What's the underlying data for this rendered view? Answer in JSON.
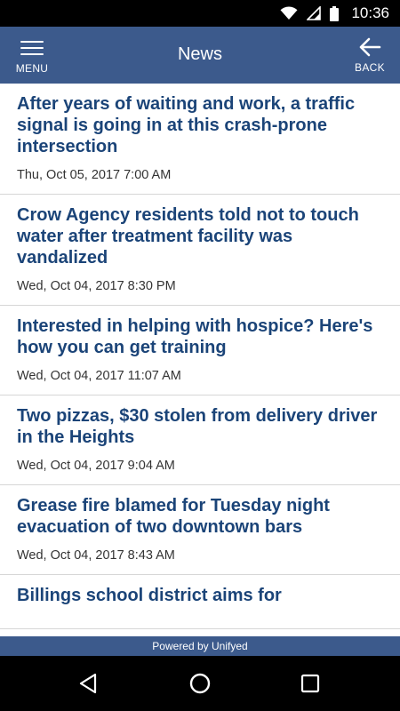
{
  "status_bar": {
    "time": "10:36",
    "icons": [
      "wifi-icon",
      "signal-icon",
      "battery-icon"
    ]
  },
  "app_bar": {
    "title": "News",
    "menu_label": "MENU",
    "back_label": "BACK",
    "background_color": "#3c5a8c"
  },
  "news": {
    "headline_color": "#1b4478",
    "items": [
      {
        "headline": "After years of waiting and work, a traffic signal is going in at this crash-prone intersection",
        "date": "Thu, Oct 05, 2017 7:00 AM"
      },
      {
        "headline": "Crow Agency residents told not to touch water after treatment facility was vandalized",
        "date": "Wed, Oct 04, 2017 8:30 PM"
      },
      {
        "headline": "Interested in helping with hospice? Here's how you can get training",
        "date": "Wed, Oct 04, 2017 11:07 AM"
      },
      {
        "headline": "Two pizzas, $30 stolen from delivery driver in the Heights",
        "date": "Wed, Oct 04, 2017 9:04 AM"
      },
      {
        "headline": "Grease fire blamed for Tuesday night evacuation of two downtown bars",
        "date": "Wed, Oct 04, 2017 8:43 AM"
      },
      {
        "headline": "Billings school district aims for",
        "date": ""
      }
    ]
  },
  "footer": {
    "powered_by": "Powered by Unifyed"
  },
  "nav_bar": {
    "buttons": [
      "back-triangle-icon",
      "home-circle-icon",
      "recents-square-icon"
    ]
  }
}
